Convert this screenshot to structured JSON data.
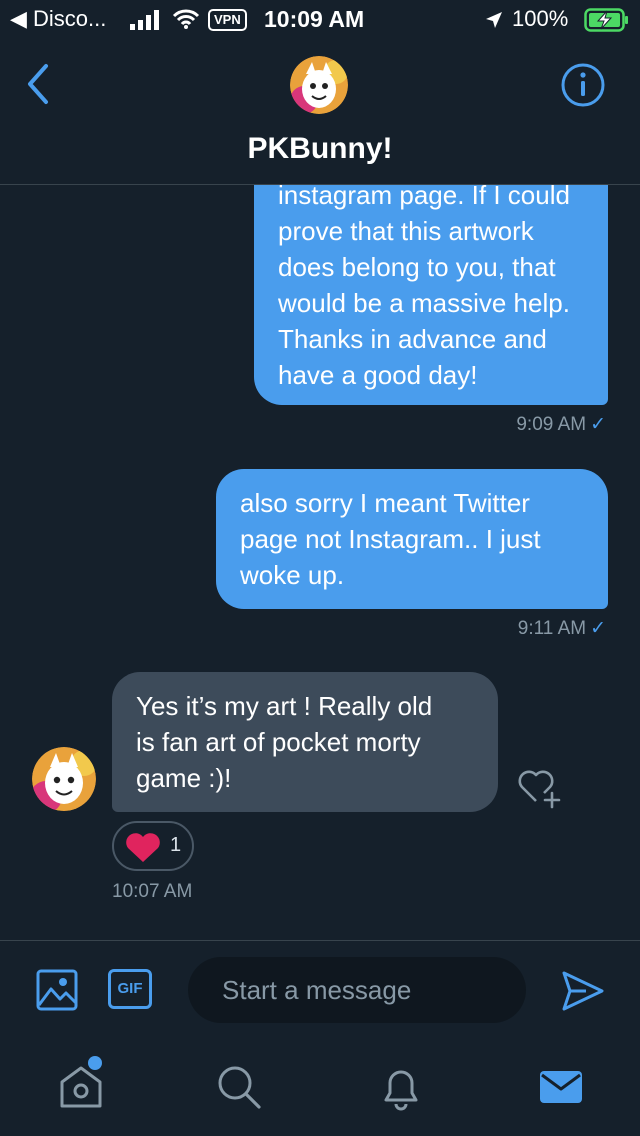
{
  "status_bar": {
    "back_app": "◀ Disco...",
    "vpn": "VPN",
    "time": "10:09 AM",
    "battery": "100%"
  },
  "header": {
    "contact_name": "PKBunny!"
  },
  "messages": [
    {
      "direction": "outgoing",
      "text": "instagram page. If I could\nprove that this artwork\ndoes belong to you, that\nwould be a massive help.\nThanks in advance and\nhave a good day!",
      "time": "9:09 AM"
    },
    {
      "direction": "outgoing",
      "text": "also sorry I meant Twitter\npage not Instagram.. I just\nwoke up.",
      "time": "9:11 AM"
    },
    {
      "direction": "incoming",
      "text": "Yes it’s my art ! Really old\nis fan art of pocket morty\ngame :)!",
      "time": "10:07 AM",
      "reaction_count": "1"
    }
  ],
  "composer": {
    "gif_label": "GIF",
    "placeholder": "Start a message"
  },
  "check_mark": "✓",
  "colors": {
    "background": "#15202b",
    "accent": "#4a9ded",
    "incoming_bubble": "#3d4b5a",
    "heart": "#e0245e",
    "battery": "#4cd964"
  },
  "icons": {
    "header": [
      "back-chevron-icon",
      "info-icon"
    ],
    "composer": [
      "image-icon",
      "gif-icon",
      "send-icon"
    ],
    "tabs": [
      "home-icon",
      "search-icon",
      "bell-icon",
      "mail-icon"
    ]
  }
}
